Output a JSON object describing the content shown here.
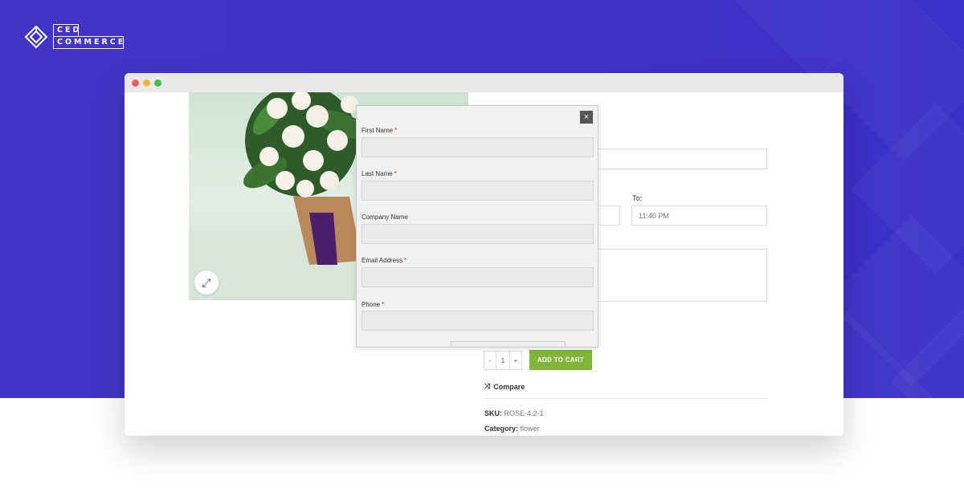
{
  "brand": {
    "line1": "CED",
    "line2": "COMMERCE"
  },
  "window_dots": [
    "#f25b5b",
    "#f5b53a",
    "#3cc34a"
  ],
  "modal": {
    "close_icon": "×",
    "fields": [
      {
        "label": "First Name",
        "required": true
      },
      {
        "label": "Last Name",
        "required": true
      },
      {
        "label": "Company Name",
        "required": false
      },
      {
        "label": "Email Address",
        "required": true
      },
      {
        "label": "Phone",
        "required": true
      }
    ]
  },
  "page": {
    "to_label": "To:",
    "to_value": "11:40 PM",
    "qty_minus": "-",
    "qty_value": "1",
    "qty_plus": "+",
    "add_to_cart": "ADD TO CART",
    "compare_label": "Compare",
    "sku_label": "SKU:",
    "sku_value": "ROSE-4.2-1",
    "category_label": "Category:",
    "category_value": "flower"
  },
  "colors": {
    "brand_bg": "#4334c4",
    "add_to_cart": "#80b53a"
  }
}
